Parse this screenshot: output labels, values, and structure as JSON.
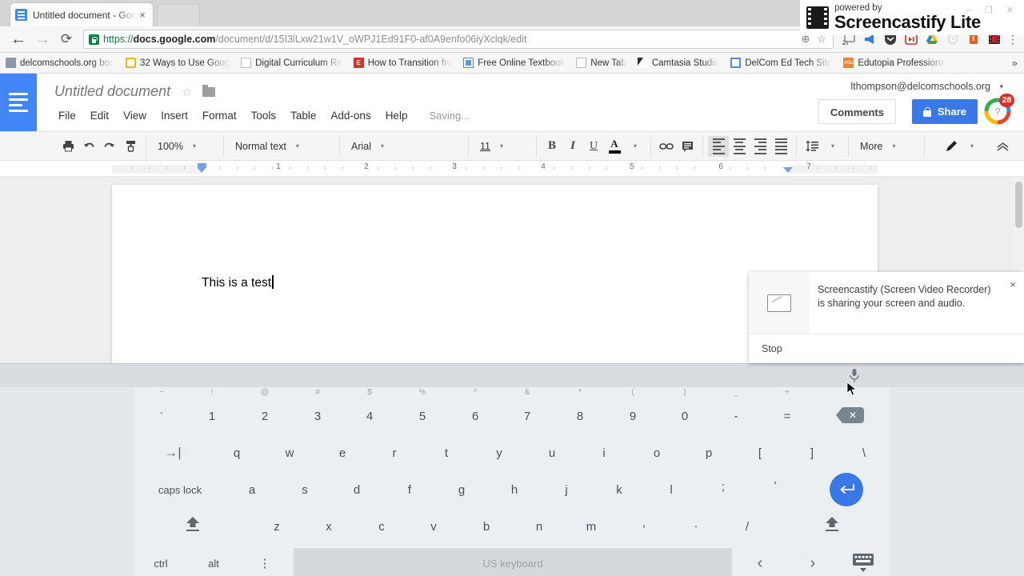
{
  "browser": {
    "tab": {
      "title": "Untitled document - Goo",
      "close_label": "×"
    },
    "url": {
      "scheme": "https://",
      "host": "docs.google.com",
      "path": "/document/d/15I3lLxw21w1V_oWPJ1Ed91F0-af0A9enfo06iyXclqk/edit"
    },
    "nav": {
      "back": "←",
      "forward": "→",
      "reload": "⟳"
    },
    "omnibox_icons": {
      "zoom": "⊕",
      "star": "☆"
    },
    "menu_dots": "⋮",
    "bookmarks": [
      {
        "label": "delcomschools.org bookmarks",
        "icon": "grid-favicon"
      },
      {
        "label": "32 Ways to Use Goog",
        "icon": "yellow-square-favicon"
      },
      {
        "label": "Digital Curriculum Re",
        "icon": "page-favicon"
      },
      {
        "label": "How to Transition fro",
        "icon": "red-e-favicon"
      },
      {
        "label": "Free Online Textbook",
        "icon": "blue-book-favicon"
      },
      {
        "label": "New Tab",
        "icon": "page-favicon"
      },
      {
        "label": "Camtasia Studio",
        "icon": "camtasia-favicon"
      },
      {
        "label": "DelCom Ed Tech Site",
        "icon": "blue-outline-favicon"
      },
      {
        "label": "Edutopia Professiona",
        "icon": "edu-favicon"
      }
    ],
    "bookmarks_overflow": "»"
  },
  "watermark": {
    "powered_by": "powered by",
    "brand": "Screencastify Lite",
    "window_controls": "– ❐ ✕"
  },
  "docs": {
    "title": "Untitled document",
    "star_icon": "☆",
    "menus": [
      "File",
      "Edit",
      "View",
      "Insert",
      "Format",
      "Tools",
      "Table",
      "Add-ons",
      "Help"
    ],
    "save_status": "Saving...",
    "account_email": "lthompson@delcomschools.org",
    "account_caret": "▾",
    "comments_label": "Comments",
    "share_label": "Share",
    "avatar_badge": "28",
    "toolbar": {
      "print": "⎙",
      "undo": "↶",
      "redo": "↷",
      "paint_format": "⎙",
      "zoom": "100%",
      "style": "Normal text",
      "font": "Arial",
      "size": "11",
      "bold": "B",
      "italic": "I",
      "underline": "U",
      "text_color": "A",
      "link": "∞",
      "comment": "⌸",
      "line_spacing": "↕",
      "more": "More",
      "edit_mode": "✎",
      "collapse": "⌃",
      "caret": "▾"
    },
    "ruler": {
      "numbers": [
        "1",
        "2",
        "3",
        "4",
        "5",
        "6",
        "7"
      ]
    },
    "document_text": "This is a test"
  },
  "notification": {
    "message_line1": "Screencastify (Screen Video Recorder)",
    "message_line2": "is sharing your screen and audio.",
    "stop_label": "Stop",
    "close_label": "×"
  },
  "keyboard": {
    "mic_icon": "mic",
    "row1": [
      {
        "main": "`",
        "sub": "~"
      },
      {
        "main": "1",
        "sub": "!"
      },
      {
        "main": "2",
        "sub": "@"
      },
      {
        "main": "3",
        "sub": "#"
      },
      {
        "main": "4",
        "sub": "$"
      },
      {
        "main": "5",
        "sub": "%"
      },
      {
        "main": "6",
        "sub": "^"
      },
      {
        "main": "7",
        "sub": "&"
      },
      {
        "main": "8",
        "sub": "*"
      },
      {
        "main": "9",
        "sub": "("
      },
      {
        "main": "0",
        "sub": ")"
      },
      {
        "main": "-",
        "sub": "_"
      },
      {
        "main": "=",
        "sub": "+"
      }
    ],
    "row2": [
      "→|",
      "q",
      "w",
      "e",
      "r",
      "t",
      "y",
      "u",
      "i",
      "o",
      "p",
      "[",
      "]",
      "\\"
    ],
    "row3": [
      "caps lock",
      "a",
      "s",
      "d",
      "f",
      "g",
      "h",
      "j",
      "k",
      "l",
      ";",
      "'"
    ],
    "row4": [
      "z",
      "x",
      "c",
      "v",
      "b",
      "n",
      "m",
      ",",
      ".",
      "/"
    ],
    "row5": {
      "ctrl": "ctrl",
      "alt": "alt",
      "dots": "⋮",
      "space": "US keyboard",
      "left": "‹",
      "right": "›"
    }
  },
  "colors": {
    "docs_blue": "#4285f4",
    "share_blue": "#3b78e7",
    "enter_blue": "#3b78e7",
    "badge_red": "#d93025",
    "secure_green": "#0b8043"
  }
}
